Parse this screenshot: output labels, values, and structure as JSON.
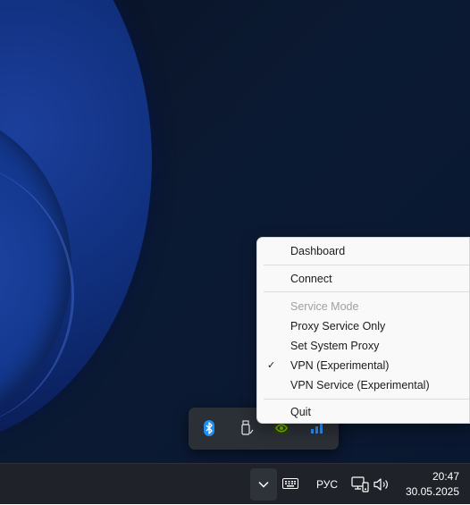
{
  "context_menu": {
    "items": [
      {
        "label": "Dashboard"
      },
      {
        "label": "Connect"
      },
      {
        "label": "Service Mode"
      },
      {
        "label": "Proxy Service Only"
      },
      {
        "label": "Set System Proxy"
      },
      {
        "label": "VPN (Experimental)"
      },
      {
        "label": "VPN Service (Experimental)"
      },
      {
        "label": "Quit"
      }
    ],
    "checked_item": "VPN (Experimental)",
    "disabled_item": "Service Mode",
    "check_symbol": "✓"
  },
  "tray_flyout": {
    "icons": [
      "bluetooth-icon",
      "usb-device-icon",
      "nvidia-icon",
      "network-activity-icon"
    ]
  },
  "taskbar": {
    "language": "РУС",
    "time": "20:47",
    "date": "30.05.2025"
  },
  "colors": {
    "bluetooth": "#1e8ff0",
    "nvidia": "#76b900",
    "accent_blue": "#2f8ef0"
  }
}
